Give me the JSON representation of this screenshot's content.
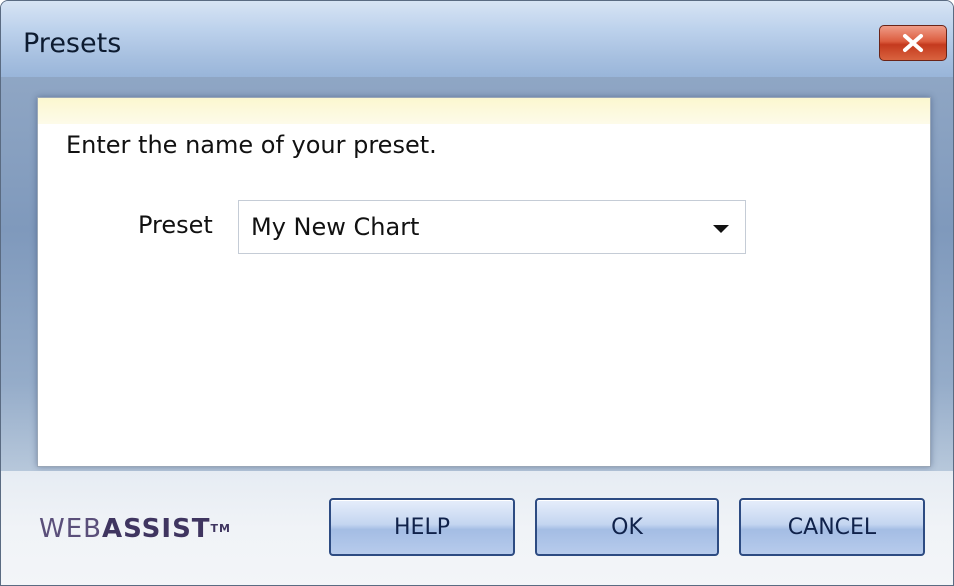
{
  "window": {
    "title": "Presets"
  },
  "dialog": {
    "prompt": "Enter the name of your preset.",
    "preset_label": "Preset",
    "preset_value": "My New Chart"
  },
  "footer": {
    "logo_web": "WEB",
    "logo_assist": "ASSIST",
    "logo_tm": "TM",
    "help_label": "HELP",
    "ok_label": "OK",
    "cancel_label": "CANCEL"
  },
  "icons": {
    "close": "close-icon",
    "dropdown": "chevron-down-icon"
  },
  "colors": {
    "close_button": "#dc5d3f",
    "button_border": "#2d4b82",
    "logo": "#3f3560"
  }
}
